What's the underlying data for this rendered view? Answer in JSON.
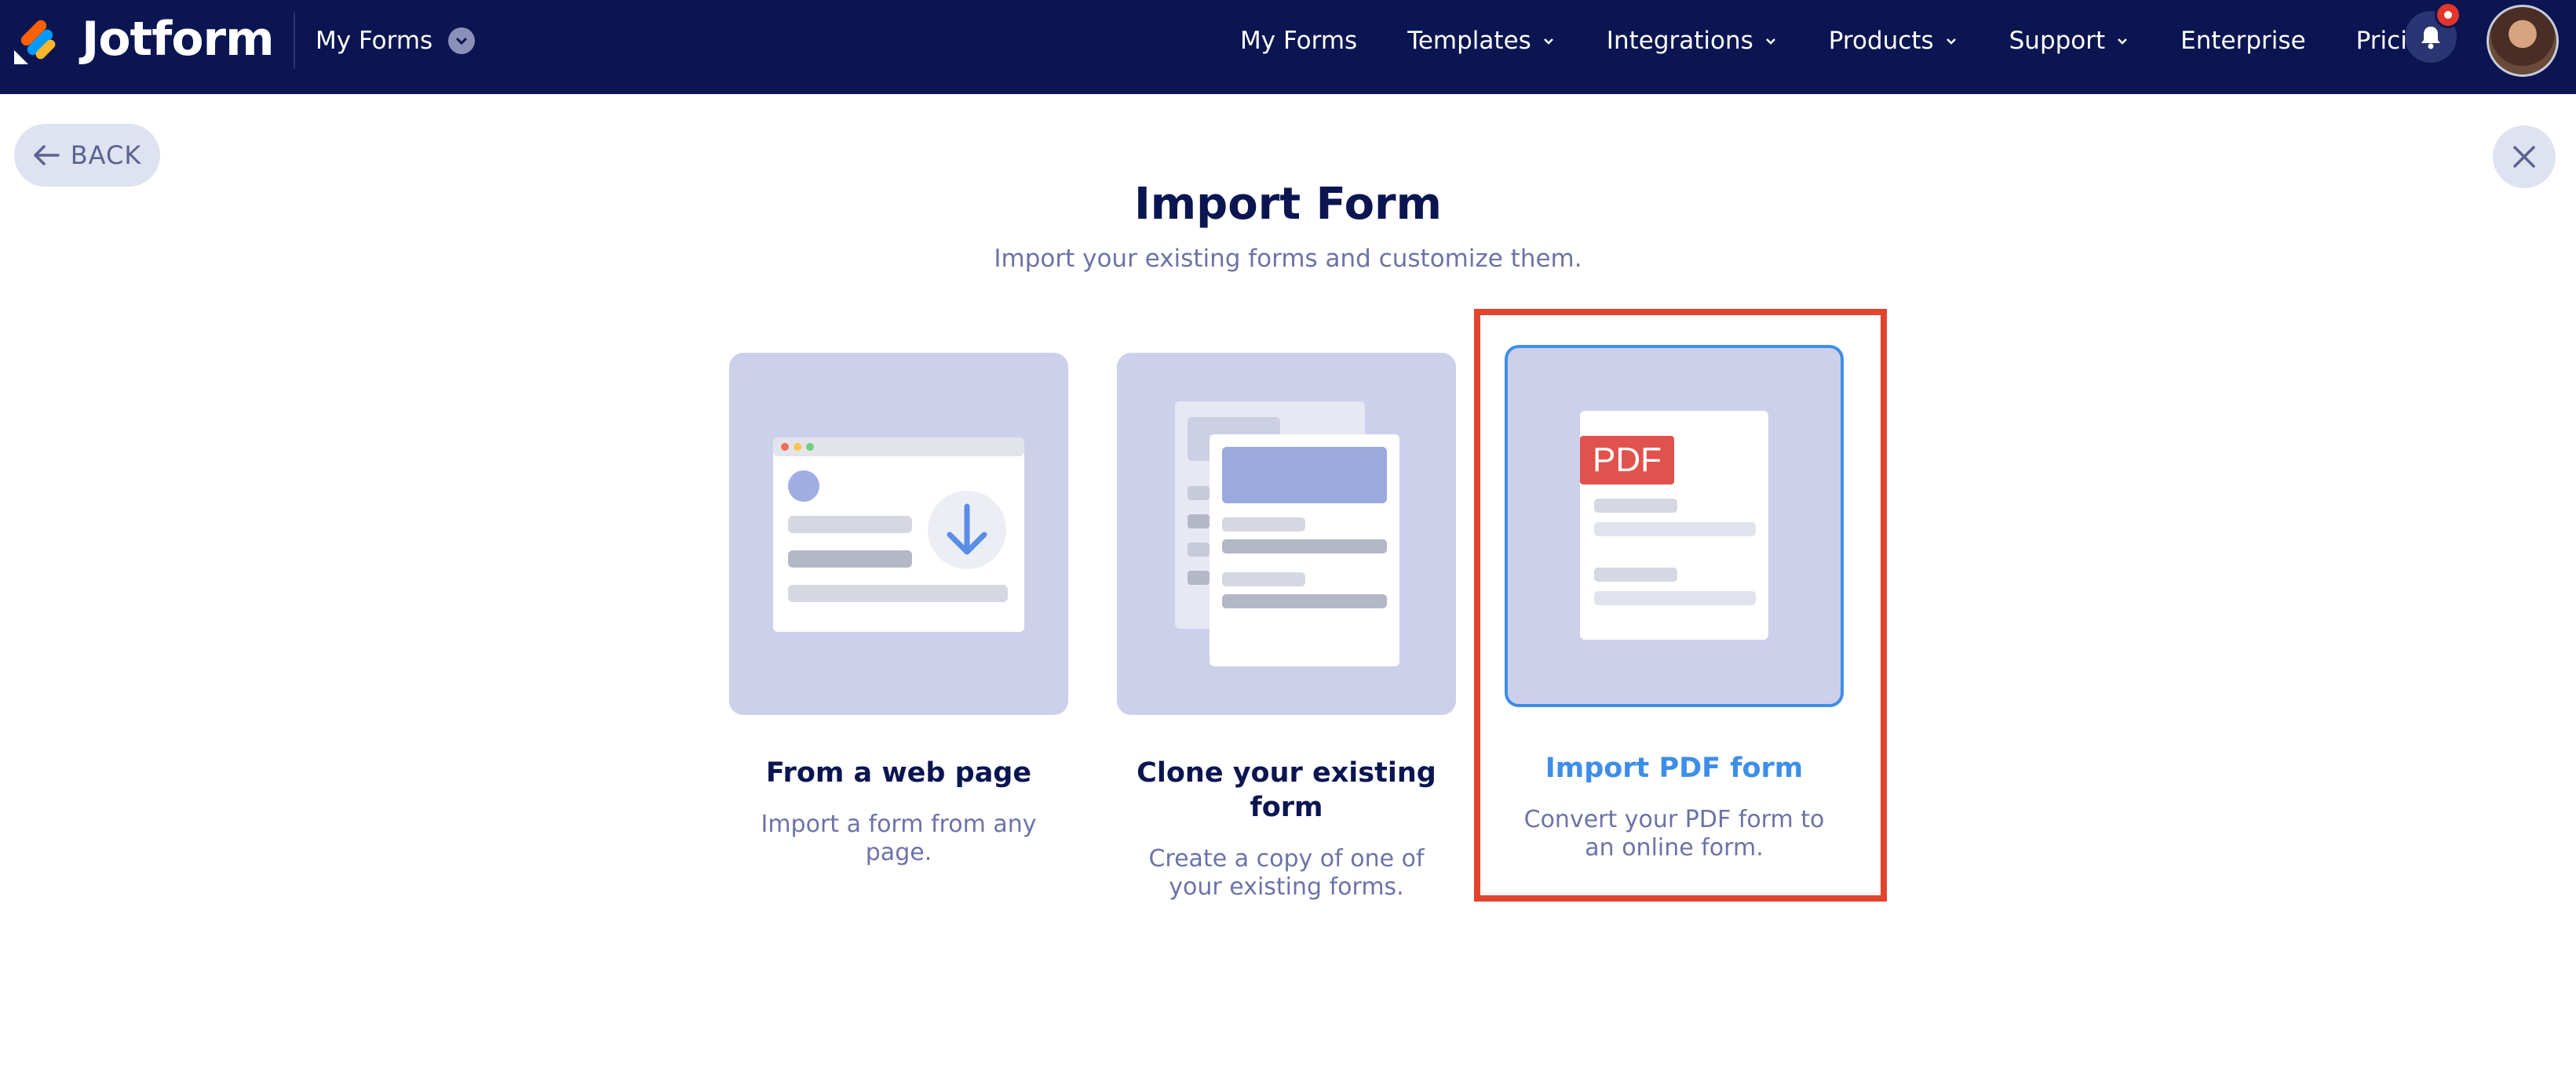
{
  "nav": {
    "brand": "Jotform",
    "switcher_label": "My Forms",
    "links": [
      {
        "label": "My Forms",
        "dropdown": false
      },
      {
        "label": "Templates",
        "dropdown": true
      },
      {
        "label": "Integrations",
        "dropdown": true
      },
      {
        "label": "Products",
        "dropdown": true
      },
      {
        "label": "Support",
        "dropdown": true
      },
      {
        "label": "Enterprise",
        "dropdown": false
      },
      {
        "label": "Pricing",
        "dropdown": false
      }
    ],
    "icons": {
      "notifications": "bell-icon",
      "profile": "avatar"
    }
  },
  "back_label": "BACK",
  "title": "Import Form",
  "subtitle": "Import your existing forms and customize them.",
  "cards": {
    "web": {
      "title": "From a web page",
      "desc": "Import a form from any page."
    },
    "clone": {
      "title": "Clone your existing form",
      "desc": "Create a copy of one of your existing forms."
    },
    "pdf": {
      "title": "Import PDF form",
      "desc": "Convert your PDF form to an online form.",
      "badge": "PDF"
    }
  },
  "colors": {
    "navbar": "#0a1551",
    "accent": "#3e8ee9",
    "highlight": "#e2442f",
    "card_bg": "#cdd0eb"
  }
}
